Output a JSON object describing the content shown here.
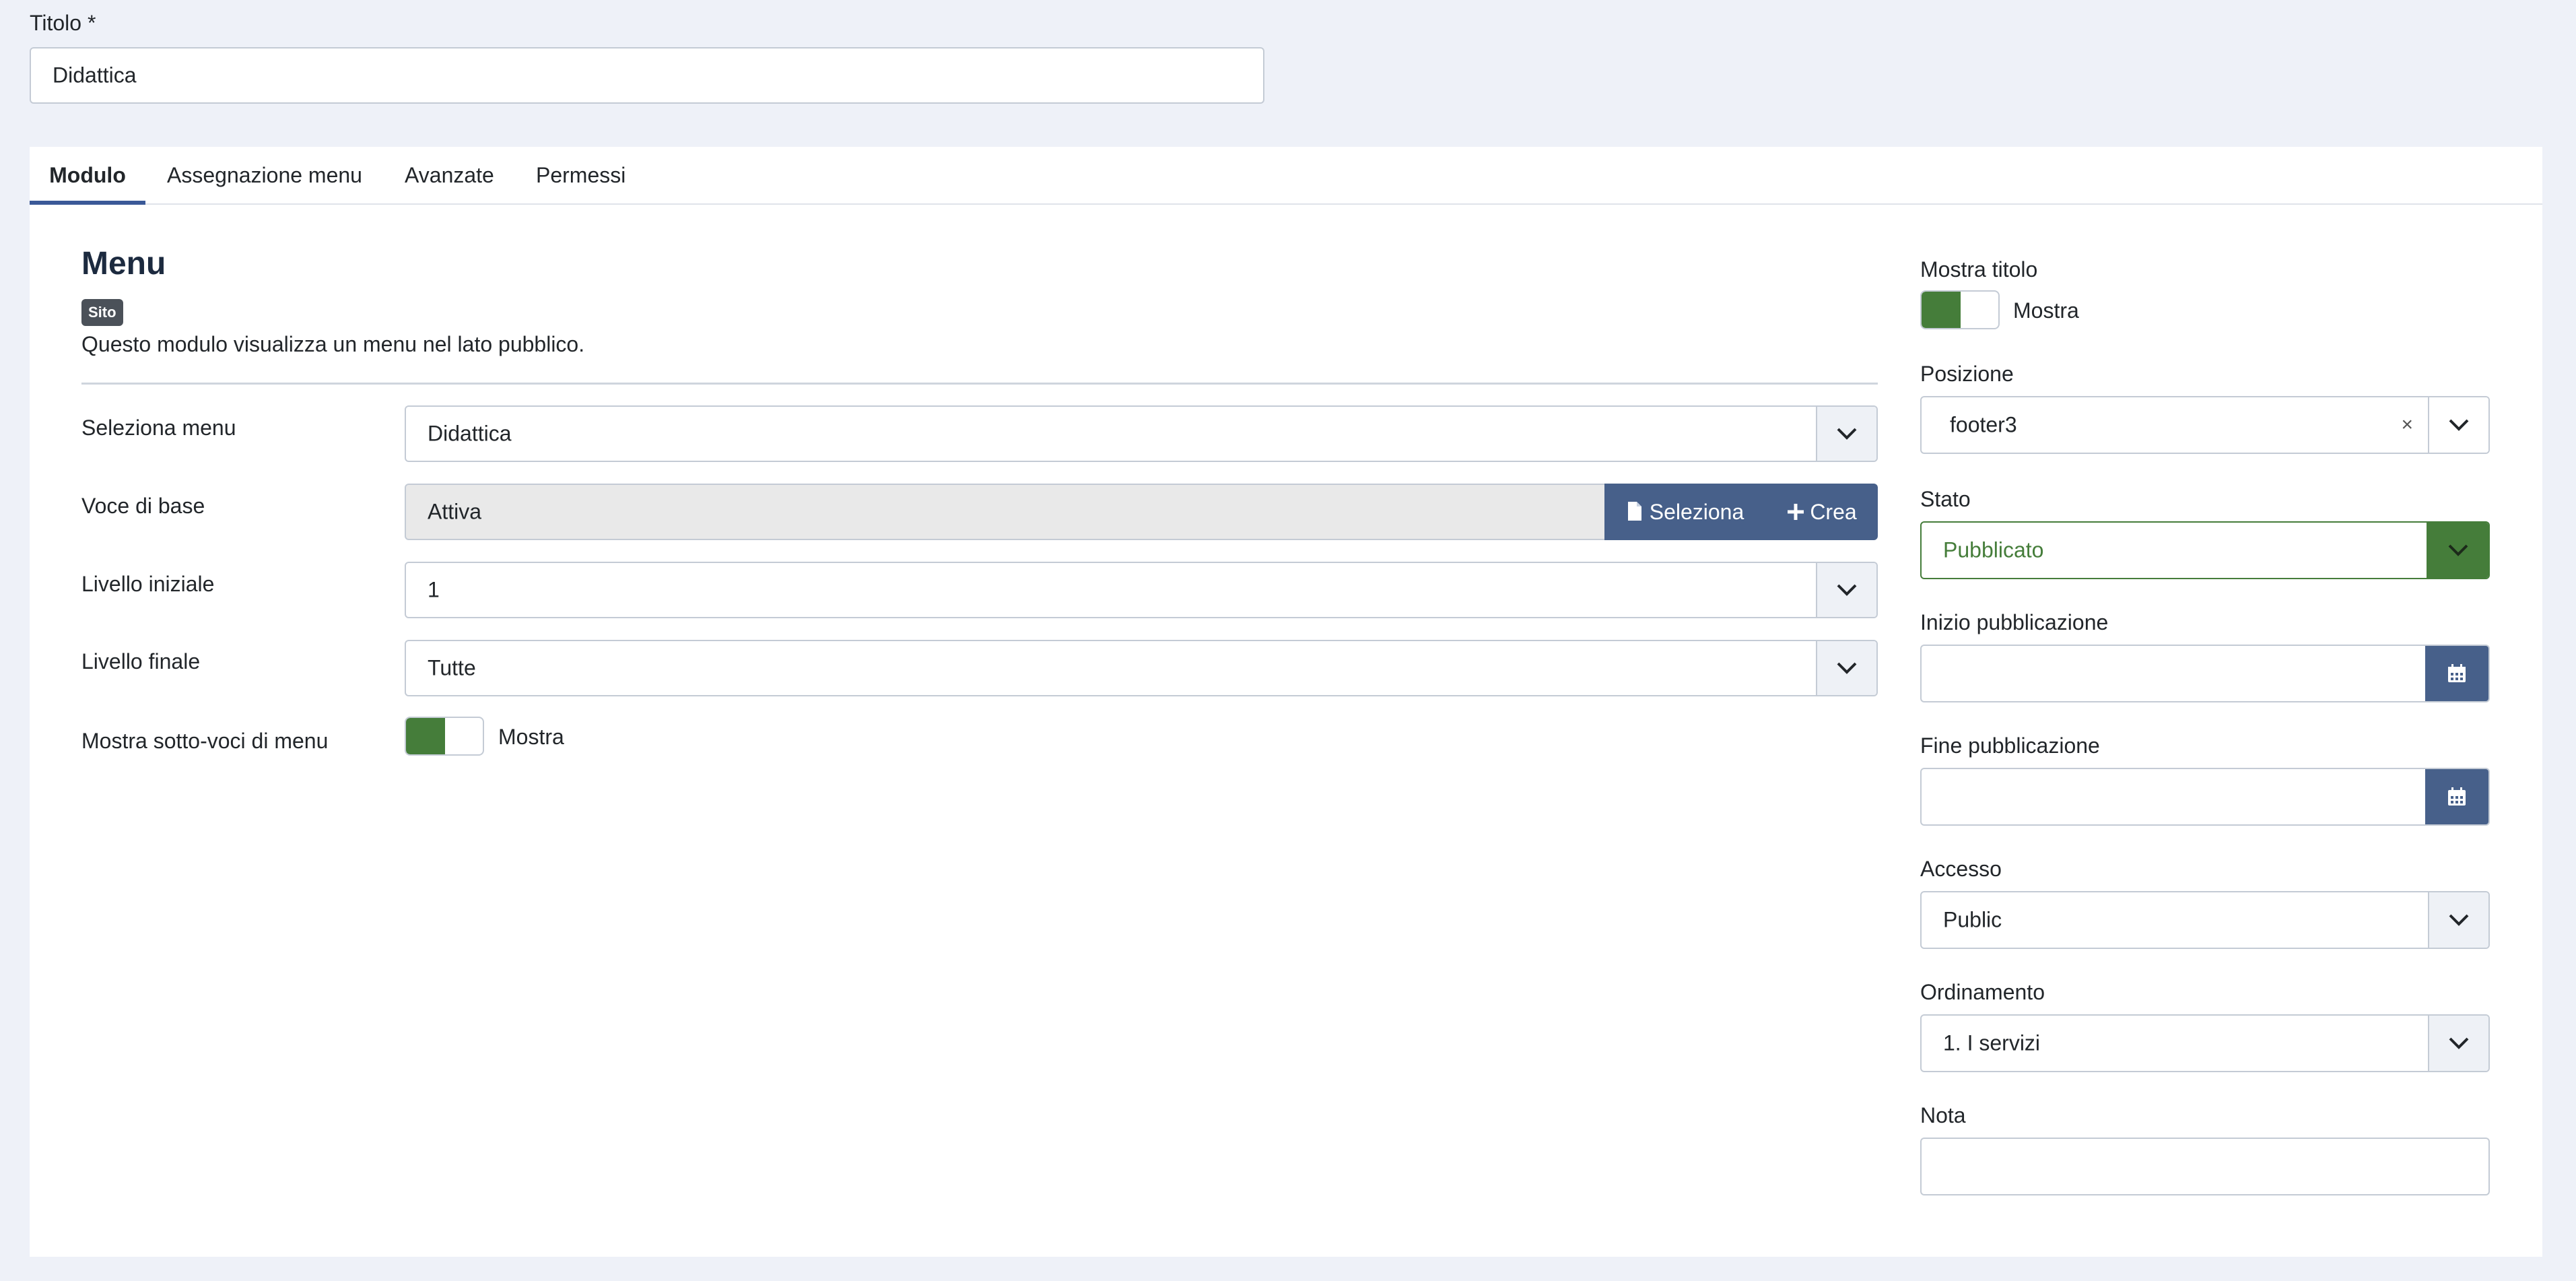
{
  "title_field": {
    "label": "Titolo *",
    "value": "Didattica"
  },
  "tabs": [
    {
      "label": "Modulo",
      "active": true
    },
    {
      "label": "Assegnazione menu",
      "active": false
    },
    {
      "label": "Avanzate",
      "active": false
    },
    {
      "label": "Permessi",
      "active": false
    }
  ],
  "module": {
    "heading": "Menu",
    "badge": "Sito",
    "description": "Questo modulo visualizza un menu nel lato pubblico."
  },
  "form": {
    "seleziona_menu": {
      "label": "Seleziona menu",
      "value": "Didattica"
    },
    "voce_di_base": {
      "label": "Voce di base",
      "value": "Attiva",
      "select_label": "Seleziona",
      "create_label": "Crea"
    },
    "livello_iniziale": {
      "label": "Livello iniziale",
      "value": "1"
    },
    "livello_finale": {
      "label": "Livello finale",
      "value": "Tutte"
    },
    "mostra_sottovoci": {
      "label": "Mostra sotto-voci di menu",
      "toggle_label": "Mostra",
      "on": true
    }
  },
  "sidebar": {
    "mostra_titolo": {
      "label": "Mostra titolo",
      "toggle_label": "Mostra",
      "on": true
    },
    "posizione": {
      "label": "Posizione",
      "value": "footer3",
      "clear": "×"
    },
    "stato": {
      "label": "Stato",
      "value": "Pubblicato"
    },
    "inizio_pubblicazione": {
      "label": "Inizio pubblicazione",
      "value": ""
    },
    "fine_pubblicazione": {
      "label": "Fine pubblicazione",
      "value": ""
    },
    "accesso": {
      "label": "Accesso",
      "value": "Public"
    },
    "ordinamento": {
      "label": "Ordinamento",
      "value": "1. I servizi"
    },
    "nota": {
      "label": "Nota",
      "value": ""
    }
  },
  "colors": {
    "accent": "#3b5998",
    "button": "#47608a",
    "success": "#457d3a",
    "background": "#eef1f8"
  }
}
